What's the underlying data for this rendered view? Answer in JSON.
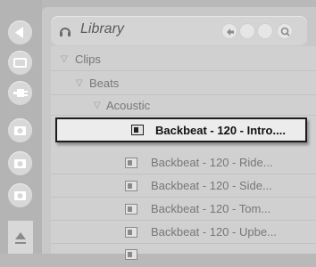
{
  "browser": {
    "title": "Library",
    "tree": {
      "clips": "Clips",
      "beats": "Beats",
      "acoustic": "Acoustic"
    },
    "files": [
      {
        "label": "Backbeat - 120 - Intro....",
        "selected": true
      },
      {
        "label": "Backbeat - 120 - Ride...",
        "selected": false
      },
      {
        "label": "Backbeat - 120 - Side...",
        "selected": false
      },
      {
        "label": "Backbeat - 120 - Tom...",
        "selected": false
      },
      {
        "label": "Backbeat - 120 - Upbe...",
        "selected": false
      }
    ]
  },
  "icons": {
    "rail": [
      "back-arrow-icon",
      "keyboard-icon",
      "plug-icon",
      "camera-icon",
      "camera-icon",
      "camera-icon",
      "scroll-up-icon"
    ],
    "header": [
      "headphones-icon",
      "back-icon",
      "nav-dot-icon",
      "nav-dot-icon",
      "search-icon"
    ]
  },
  "colors": {
    "selection_border": "#1c1c1c",
    "selection_bg": "#ececec",
    "panel_bg": "#d0d0d0"
  }
}
